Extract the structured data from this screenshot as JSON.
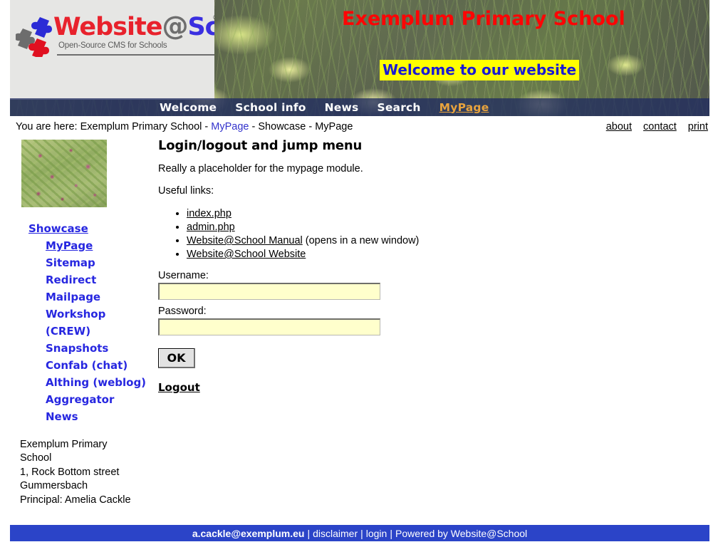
{
  "site": {
    "logo": {
      "word_red": "Website",
      "word_at": "@",
      "word_blue": "School",
      "registered": "®",
      "tagline": "Open-Source CMS for Schools"
    },
    "school_name": "Exemplum Primary School",
    "slogan": "Welcome to our website"
  },
  "nav": {
    "items": [
      {
        "label": "Welcome",
        "current": false
      },
      {
        "label": "School info",
        "current": false
      },
      {
        "label": "News",
        "current": false
      },
      {
        "label": "Search",
        "current": false
      },
      {
        "label": "MyPage",
        "current": true
      }
    ]
  },
  "breadcrumb": {
    "prefix": "You are here:",
    "root": "Exemplum Primary School",
    "sep": " - ",
    "link": "MyPage",
    "tail_a": "Showcase",
    "tail_b": "MyPage",
    "full": "You are here: Exemplum Primary School - MyPage - Showcase - MyPage"
  },
  "utility_links": [
    {
      "label": "about"
    },
    {
      "label": "contact"
    },
    {
      "label": "print"
    }
  ],
  "sidebar": {
    "image_alt": "decorative-flowers-thumbnail",
    "menu": [
      {
        "label": "Showcase",
        "level": 1,
        "selected": true
      },
      {
        "label": "MyPage",
        "level": 2,
        "selected": true
      },
      {
        "label": "Sitemap",
        "level": 2,
        "selected": false
      },
      {
        "label": "Redirect",
        "level": 2,
        "selected": false
      },
      {
        "label": "Mailpage",
        "level": 2,
        "selected": false
      },
      {
        "label": "Workshop (CREW)",
        "level": 2,
        "selected": false
      },
      {
        "label": "Snapshots",
        "level": 2,
        "selected": false
      },
      {
        "label": "Confab (chat)",
        "level": 2,
        "selected": false
      },
      {
        "label": "Althing (weblog)",
        "level": 2,
        "selected": false
      },
      {
        "label": "Aggregator",
        "level": 2,
        "selected": false
      },
      {
        "label": "News",
        "level": 2,
        "selected": false
      }
    ],
    "address": "Exemplum Primary School\n1, Rock Bottom street\nGummersbach\nPrincipal: Amelia Cackle"
  },
  "main": {
    "heading": "Login/logout and jump menu",
    "intro": "Really a placeholder for the mypage module.",
    "links_heading": "Useful links:",
    "links": [
      {
        "label": "index.php",
        "suffix": ""
      },
      {
        "label": "admin.php",
        "suffix": ""
      },
      {
        "label": "Website@School Manual",
        "suffix": " (opens in a new window)"
      },
      {
        "label": "Website@School Website",
        "suffix": ""
      }
    ],
    "form": {
      "username_label": "Username:",
      "username_value": "",
      "username_placeholder": "",
      "password_label": "Password:",
      "password_value": "",
      "password_placeholder": "",
      "submit_label": "OK",
      "logout_label": "Logout"
    }
  },
  "footer": {
    "email": "a.cackle@exemplum.eu",
    "sep": "|",
    "disclaimer": "disclaimer",
    "login": "login",
    "powered_by": "Powered by Website@School"
  },
  "colors": {
    "nav_bar": "#202c60",
    "nav_current": "#e8a33d",
    "school_name": "#fc0505",
    "slogan_bg": "#ffff00",
    "slogan_text": "#1a1ad4",
    "menu_link": "#2727e0",
    "footer_bar": "#2b44c8",
    "input_bg": "#ffffcc"
  }
}
